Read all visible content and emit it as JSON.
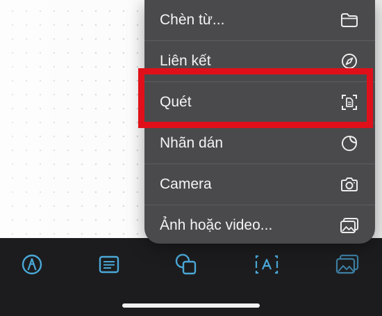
{
  "menu": {
    "items": [
      {
        "label": "Chèn từ...",
        "icon": "folder-icon"
      },
      {
        "label": "Liên kết",
        "icon": "compass-icon"
      },
      {
        "label": "Quét",
        "icon": "document-scan-icon"
      },
      {
        "label": "Nhãn dán",
        "icon": "sticker-icon"
      },
      {
        "label": "Camera",
        "icon": "camera-icon"
      },
      {
        "label": "Ảnh hoặc video...",
        "icon": "photo-library-icon"
      }
    ],
    "highlighted_item": "Quét"
  },
  "toolbar": {
    "tools": [
      {
        "name": "markup-pen",
        "icon": "markup-icon"
      },
      {
        "name": "text-box",
        "icon": "text-box-icon"
      },
      {
        "name": "shapes",
        "icon": "shapes-icon"
      },
      {
        "name": "text",
        "icon": "text-icon"
      },
      {
        "name": "media",
        "icon": "photo-icon"
      }
    ]
  },
  "colors": {
    "accent": "#4aa8d8",
    "menu_bg": "#4a4a4c",
    "toolbar_bg": "#1c1c1e",
    "highlight": "#e0101a"
  }
}
